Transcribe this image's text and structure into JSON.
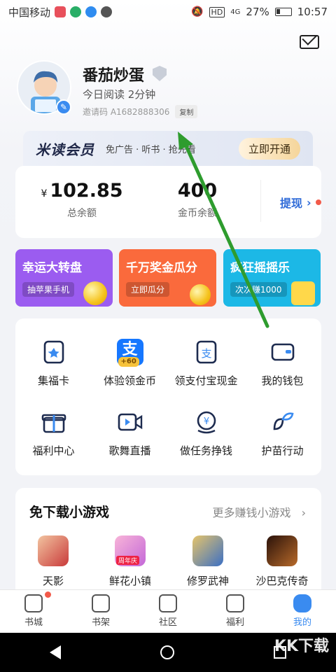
{
  "status_bar": {
    "carrier": "中国移动",
    "battery": "27%",
    "time": "10:57",
    "network": "4G"
  },
  "profile": {
    "username": "番茄炒蛋",
    "read_today": "今日阅读 2分钟",
    "invite_code": "邀请码 A1682888306",
    "copy_label": "复制"
  },
  "vip": {
    "title": "米读会员",
    "subtitle": "免广告 · 听书 · 抢先看",
    "cta": "立即开通"
  },
  "balance": {
    "currency": "¥",
    "total_value": "102.85",
    "total_label": "总余额",
    "coins_value": "400",
    "coins_label": "金币余额",
    "withdraw_label": "提现"
  },
  "promos": [
    {
      "title": "幸运大转盘",
      "tag": "抽苹果手机",
      "color": "#9b5cf0"
    },
    {
      "title": "千万奖金瓜分",
      "tag": "立即瓜分",
      "color": "#fa6a3c"
    },
    {
      "title": "疯狂摇摇乐",
      "tag": "次次赚1000",
      "color": "#1cb8e6"
    }
  ],
  "features": [
    {
      "label": "集福卡",
      "icon": "card-icon"
    },
    {
      "label": "体验领金币",
      "icon": "alipay-coin-icon"
    },
    {
      "label": "领支付宝现金",
      "icon": "alipay-cash-icon"
    },
    {
      "label": "我的钱包",
      "icon": "wallet-icon"
    },
    {
      "label": "福利中心",
      "icon": "gift-icon"
    },
    {
      "label": "歌舞直播",
      "icon": "live-icon"
    },
    {
      "label": "做任务挣钱",
      "icon": "task-money-icon"
    },
    {
      "label": "护苗行动",
      "icon": "sprout-icon"
    }
  ],
  "alipay_badge": "+60",
  "games": {
    "title": "免下载小游戏",
    "more": "更多赚钱小游戏",
    "items": [
      {
        "label": "天影",
        "color": "#c93a3a"
      },
      {
        "label": "鲜花小镇",
        "color": "#c468d8",
        "badge": "周年庆"
      },
      {
        "label": "修罗武神",
        "color": "#3b6fc4"
      },
      {
        "label": "沙巴克传奇",
        "color": "#5a2a12"
      }
    ]
  },
  "tabs": [
    {
      "label": "书城",
      "dot": true
    },
    {
      "label": "书架"
    },
    {
      "label": "社区"
    },
    {
      "label": "福利"
    },
    {
      "label": "我的",
      "active": true
    }
  ],
  "watermark": "KK下载",
  "colors": {
    "accent": "#3a8bf0",
    "arrow": "#2e9c2e"
  }
}
